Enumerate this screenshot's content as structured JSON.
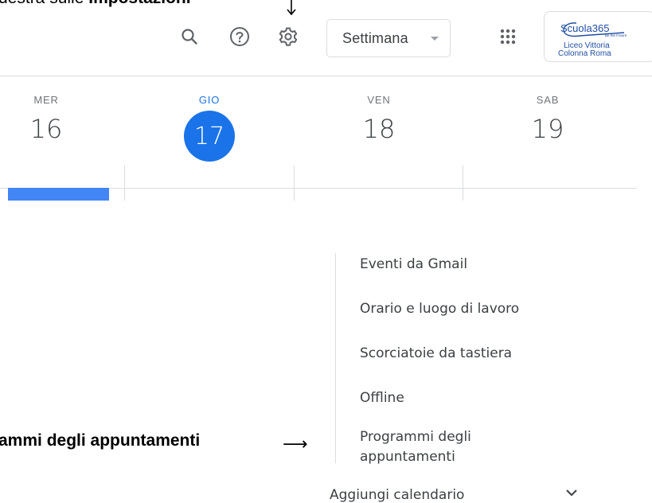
{
  "caption_top": {
    "prefix": "destra sulle ",
    "bold": "Impostazioni"
  },
  "caption_bottom": {
    "text": "ammi degli appuntamenti",
    "arrow": "⟶"
  },
  "toolbar": {
    "icons": [
      "search-icon",
      "help-icon",
      "settings-gear-icon",
      "apps-grid-icon"
    ],
    "view_selector": "Settimana"
  },
  "logo": {
    "brand": "Scuola365",
    "tagline": "Be the Future",
    "line1": "Liceo Vittoria",
    "line2": "Colonna Roma"
  },
  "days": [
    {
      "name": "MER",
      "number": "16",
      "today": false
    },
    {
      "name": "GIO",
      "number": "17",
      "today": true
    },
    {
      "name": "VEN",
      "number": "18",
      "today": false
    },
    {
      "name": "SAB",
      "number": "19",
      "today": false
    }
  ],
  "settings_menu": {
    "items": [
      "Eventi da Gmail",
      "Orario e luogo di lavoro",
      "Scorciatoie da tastiera",
      "Offline",
      "Programmi degli",
      "appuntamenti"
    ]
  },
  "sidebar": {
    "add_calendar": "Aggiungi calendario"
  },
  "colors": {
    "accent": "#1a73e8",
    "event_bar": "#4285f4",
    "divider": "#dadce0",
    "text": "#3c4043"
  }
}
